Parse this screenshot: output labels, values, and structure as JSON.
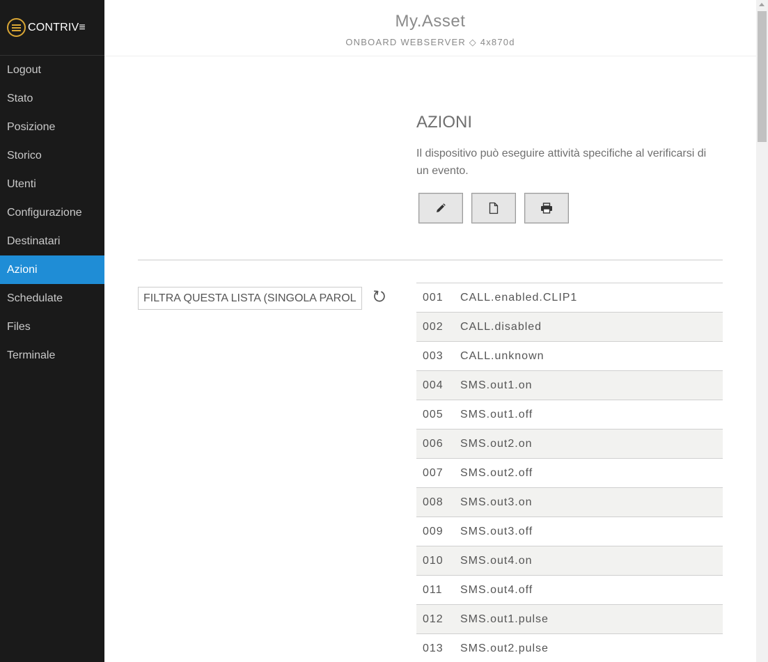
{
  "brand": {
    "logo_text": "CONTRIV≡"
  },
  "header": {
    "title": "My.Asset",
    "subtitle": "ONBOARD WEBSERVER ◇ 4x870d"
  },
  "sidebar": {
    "items": [
      {
        "label": "Logout"
      },
      {
        "label": "Stato"
      },
      {
        "label": "Posizione"
      },
      {
        "label": "Storico"
      },
      {
        "label": "Utenti"
      },
      {
        "label": "Configurazione"
      },
      {
        "label": "Destinatari"
      },
      {
        "label": "Azioni",
        "active": true
      },
      {
        "label": "Schedulate"
      },
      {
        "label": "Files"
      },
      {
        "label": "Terminale"
      }
    ]
  },
  "main": {
    "title": "AZIONI",
    "description": "Il dispositivo può eseguire attività specifiche al verificarsi di un evento.",
    "toolbar": {
      "edit_icon": "pencil-icon",
      "new_icon": "file-icon",
      "print_icon": "print-icon"
    },
    "filter": {
      "placeholder": "FILTRA QUESTA LISTA (SINGOLA PAROLA)",
      "reset_icon": "undo-icon"
    },
    "actions": [
      {
        "num": "001",
        "name": "CALL.enabled.CLIP1"
      },
      {
        "num": "002",
        "name": "CALL.disabled"
      },
      {
        "num": "003",
        "name": "CALL.unknown"
      },
      {
        "num": "004",
        "name": "SMS.out1.on"
      },
      {
        "num": "005",
        "name": "SMS.out1.off"
      },
      {
        "num": "006",
        "name": "SMS.out2.on"
      },
      {
        "num": "007",
        "name": "SMS.out2.off"
      },
      {
        "num": "008",
        "name": "SMS.out3.on"
      },
      {
        "num": "009",
        "name": "SMS.out3.off"
      },
      {
        "num": "010",
        "name": "SMS.out4.on"
      },
      {
        "num": "011",
        "name": "SMS.out4.off"
      },
      {
        "num": "012",
        "name": "SMS.out1.pulse"
      },
      {
        "num": "013",
        "name": "SMS.out2.pulse"
      }
    ]
  },
  "colors": {
    "sidebar_bg": "#1a1a1a",
    "active_item": "#1f8dd6",
    "logo_accent": "#d9a635",
    "row_stripe": "#f2f2f0"
  }
}
